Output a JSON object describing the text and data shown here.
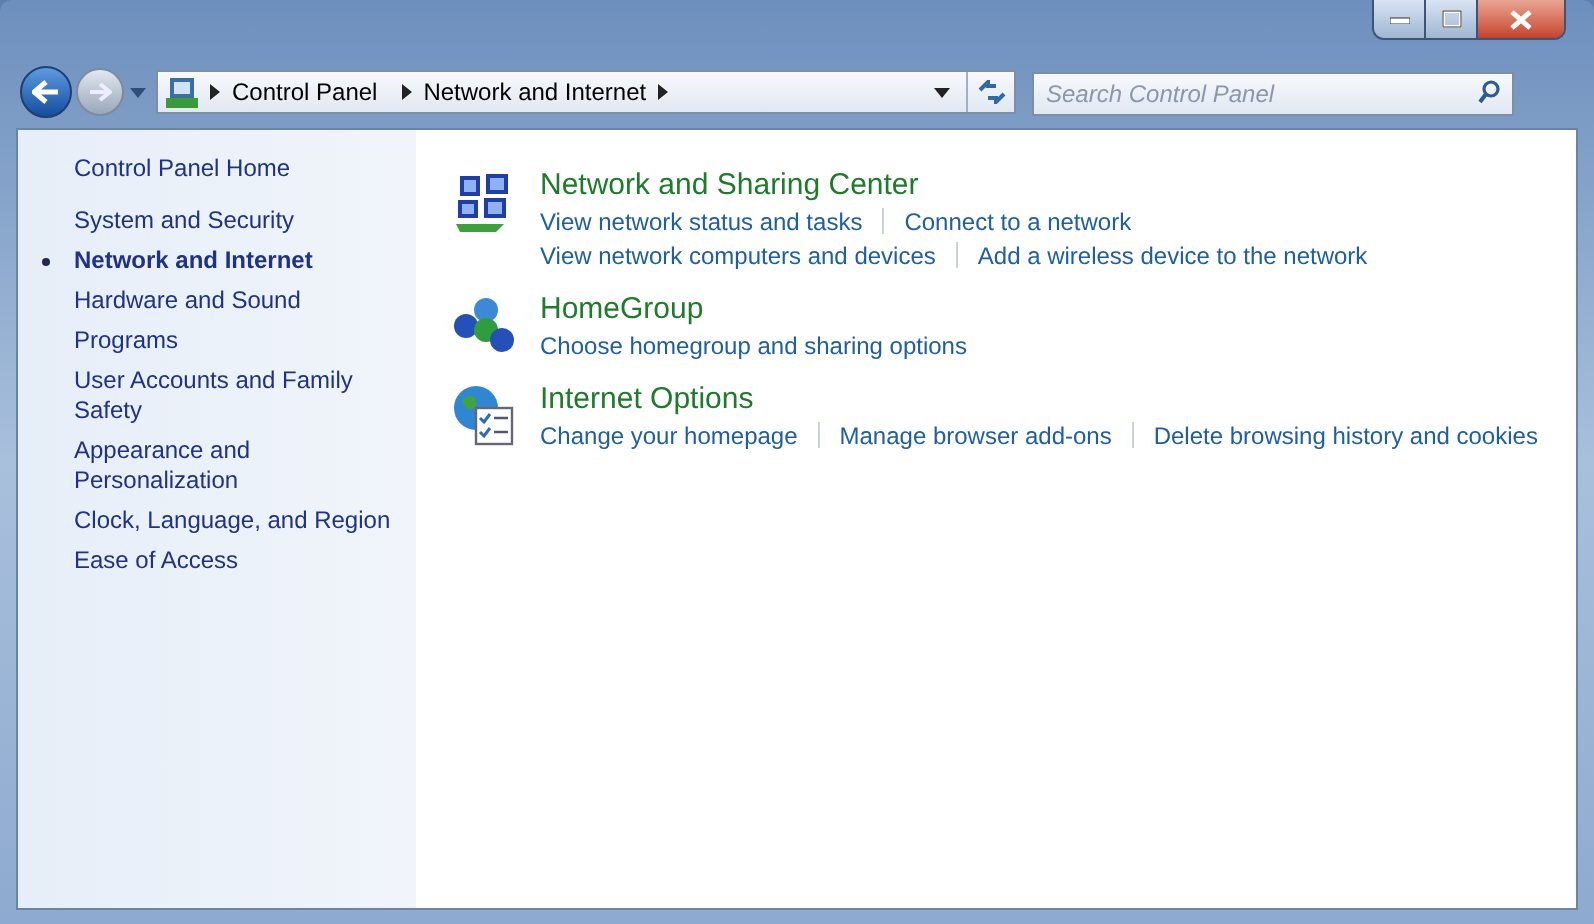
{
  "address_bar": {
    "crumbs": [
      "Control Panel",
      "Network and Internet"
    ]
  },
  "search": {
    "placeholder": "Search Control Panel"
  },
  "sidebar": {
    "items": [
      {
        "label": "Control Panel Home",
        "kind": "home",
        "selected": false
      },
      {
        "label": "System and Security",
        "kind": "category",
        "selected": false
      },
      {
        "label": "Network and Internet",
        "kind": "category",
        "selected": true
      },
      {
        "label": "Hardware and Sound",
        "kind": "category",
        "selected": false
      },
      {
        "label": "Programs",
        "kind": "category",
        "selected": false
      },
      {
        "label": "User Accounts and Family Safety",
        "kind": "category",
        "selected": false
      },
      {
        "label": "Appearance and Personalization",
        "kind": "category",
        "selected": false
      },
      {
        "label": "Clock, Language, and Region",
        "kind": "category",
        "selected": false
      },
      {
        "label": "Ease of Access",
        "kind": "category",
        "selected": false
      }
    ]
  },
  "sections": [
    {
      "title": "Network and Sharing Center",
      "kind": "network",
      "link_lines": [
        [
          "View network status and tasks",
          "Connect to a network"
        ],
        [
          "View network computers and devices",
          "Add a wireless device to the network"
        ]
      ]
    },
    {
      "title": "HomeGroup",
      "kind": "homegroup",
      "link_lines": [
        [
          "Choose homegroup and sharing options"
        ]
      ]
    },
    {
      "title": "Internet Options",
      "kind": "internet",
      "link_lines": [
        [
          "Change your homepage",
          "Manage browser add-ons",
          "Delete browsing history and cookies"
        ]
      ]
    }
  ]
}
